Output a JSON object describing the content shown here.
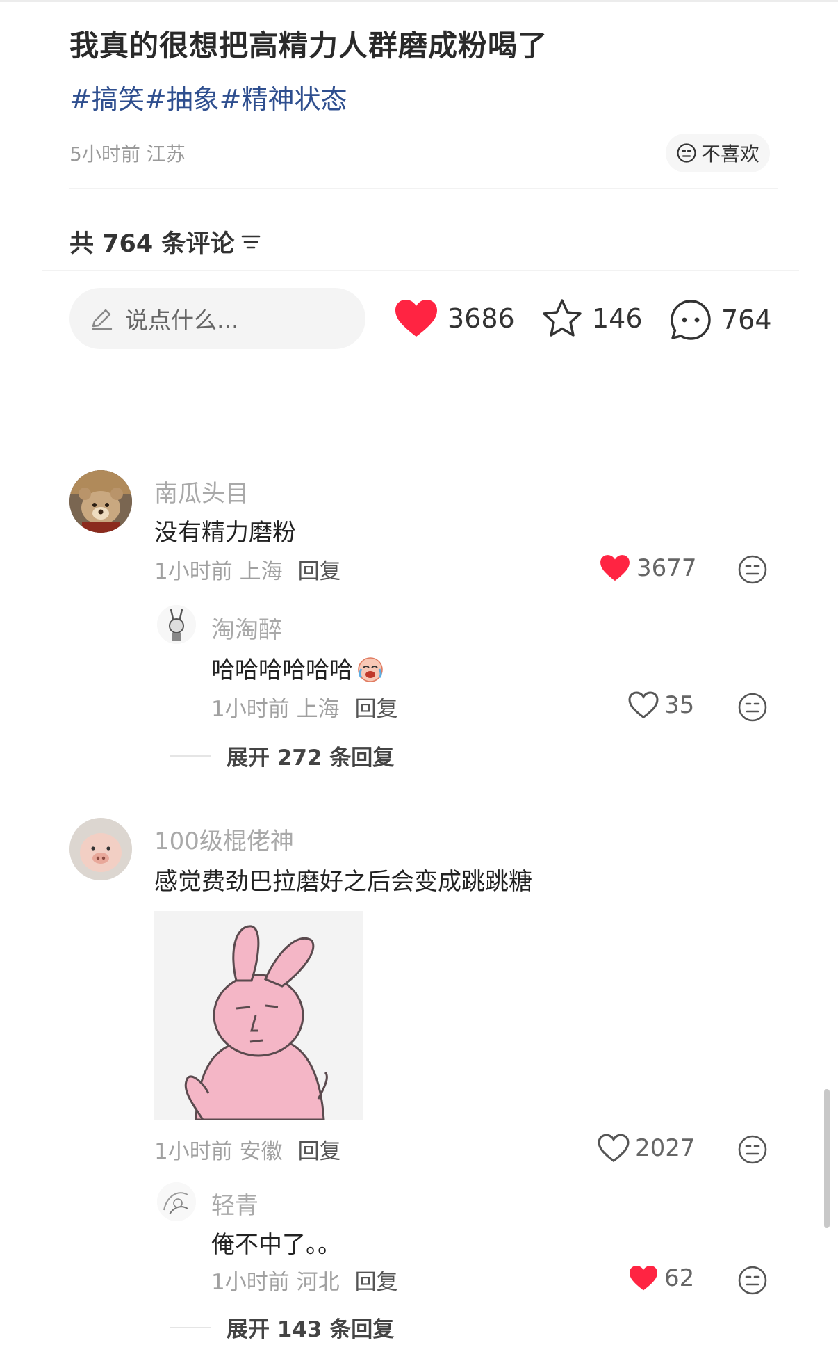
{
  "post": {
    "title": "我真的很想把高精力人群磨成粉喝了",
    "tags": "#搞笑#抽象#精神状态",
    "time_location": "5小时前 江苏",
    "dislike_label": "不喜欢"
  },
  "comments_header": {
    "count_label": "共 764 条评论"
  },
  "action_bar": {
    "input_placeholder": "说点什么...",
    "likes": "3686",
    "favorites": "146",
    "comments": "764"
  },
  "comments": [
    {
      "name": "南瓜头目",
      "text": "没有精力磨粉",
      "meta": "1小时前 上海",
      "reply_label": "回复",
      "likes": "3677",
      "liked": true,
      "replies": [
        {
          "name": "淘淘醉",
          "text": "哈哈哈哈哈哈",
          "meta": "1小时前 上海",
          "reply_label": "回复",
          "likes": "35",
          "liked": false
        }
      ],
      "expand_label": "展开 272 条回复"
    },
    {
      "name": "100级棍佬神",
      "text": "感觉费劲巴拉磨好之后会变成跳跳糖",
      "meta": "1小时前 安徽",
      "reply_label": "回复",
      "likes": "2027",
      "liked": false,
      "replies": [
        {
          "name": "轻青",
          "text": "俺不中了。。",
          "meta": "1小时前 河北",
          "reply_label": "回复",
          "likes": "62",
          "liked": true
        }
      ],
      "expand_label": "展开 143 条回复"
    }
  ],
  "colors": {
    "like_red": "#ff2442",
    "tag_blue": "#2f4f8f",
    "muted_gray": "#a9a9a9"
  },
  "icons": [
    "pencil-icon",
    "heart-icon",
    "star-icon",
    "comment-bubble-icon",
    "neutral-face-icon",
    "sort-icon"
  ]
}
